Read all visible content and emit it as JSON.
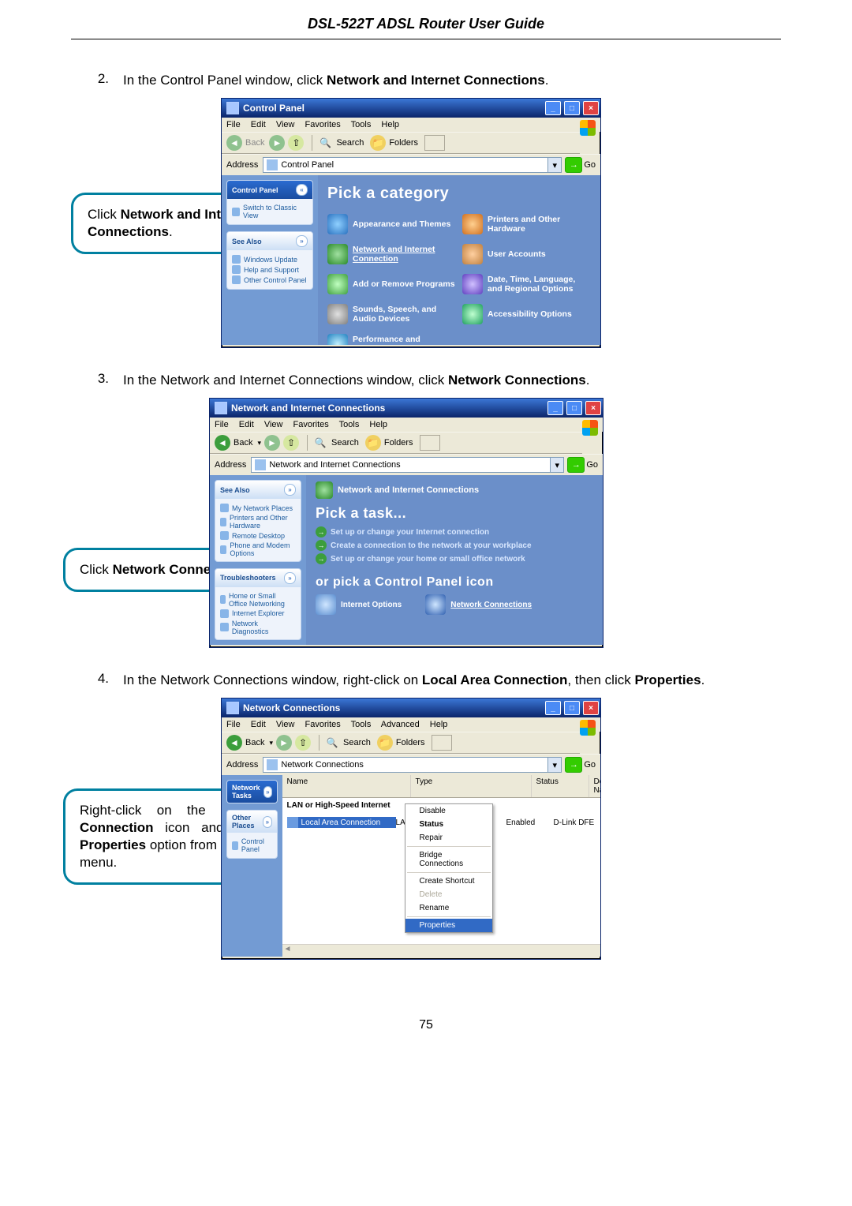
{
  "header_title": "DSL-522T ADSL Router User Guide",
  "page_number": "75",
  "steps": {
    "s2_num": "2.",
    "s2_text_prefix": "In the Control Panel window, click ",
    "s2_text_bold": "Network and Internet Connections",
    "s2_text_suffix": ".",
    "s3_num": "3.",
    "s3_text_prefix": "In the Network and Internet Connections window, click ",
    "s3_text_bold": "Network Connections",
    "s3_text_suffix": ".",
    "s4_num": "4.",
    "s4_text_prefix": "In the Network Connections window, right-click on ",
    "s4_text_bold1": "Local Area Connection",
    "s4_text_mid": ", then click ",
    "s4_text_bold2": "Properties",
    "s4_text_suffix": "."
  },
  "callouts": {
    "c1_pre": "Click ",
    "c1_b1": "Network and Internet Connections",
    "c1_post": ".",
    "c2_pre": "Click ",
    "c2_b1": "Network Connections",
    "c2_post": ".",
    "c3_line1_pre": "Right-click on the ",
    "c3_line1_b1": "Local Area Connection",
    "c3_line1_mid": " icon and select the ",
    "c3_line1_b2": "Properties",
    "c3_line1_post": " option from the pull-down menu."
  },
  "menus": [
    "File",
    "Edit",
    "View",
    "Favorites",
    "Tools",
    "Help"
  ],
  "menus2": [
    "File",
    "Edit",
    "View",
    "Favorites",
    "Tools",
    "Advanced",
    "Help"
  ],
  "toolbar": {
    "back": "Back",
    "search": "Search",
    "folders": "Folders"
  },
  "addressLabel": "Address",
  "go": "Go",
  "win1": {
    "title": "Control Panel",
    "addr": "Control Panel",
    "side_h1": "Control Panel",
    "side_link1": "Switch to Classic View",
    "side_h2": "See Also",
    "side_l2a": "Windows Update",
    "side_l2b": "Help and Support",
    "side_l2c": "Other Control Panel",
    "heading": "Pick a category",
    "cats": {
      "c0": "Appearance and Themes",
      "c1": "Printers and Other Hardware",
      "c2": "Network and Internet Connection",
      "c3": "User Accounts",
      "c4": "Add or Remove Programs",
      "c5": "Date, Time, Language, and Regional Options",
      "c6": "Sounds, Speech, and Audio Devices",
      "c7": "Accessibility Options",
      "c8": "Performance and Maintenance"
    }
  },
  "win2": {
    "title": "Network and Internet Connections",
    "addr": "Network and Internet Connections",
    "side_h1": "See Also",
    "side_l1a": "My Network Places",
    "side_l1b": "Printers and Other Hardware",
    "side_l1c": "Remote Desktop",
    "side_l1d": "Phone and Modem Options",
    "side_h2": "Troubleshooters",
    "side_l2a": "Home or Small Office Networking",
    "side_l2b": "Internet Explorer",
    "side_l2c": "Network Diagnostics",
    "crumb": "Network and Internet Connections",
    "heading1": "Pick a task...",
    "t1": "Set up or change your Internet connection",
    "t2": "Create a connection to the network at your workplace",
    "t3": "Set up or change your home or small office network",
    "heading2": "or pick a Control Panel icon",
    "i1": "Internet Options",
    "i2": "Network Connections"
  },
  "win3": {
    "title": "Network Connections",
    "addr": "Network Connections",
    "side_h1": "Network Tasks",
    "side_h2": "Other Places",
    "side_l2a": "Control Panel",
    "cols": {
      "name": "Name",
      "type": "Type",
      "status": "Status",
      "device": "Device Na"
    },
    "group": "LAN or High-Speed Internet",
    "conn_name": "Local Area Connection",
    "conn_type": "LAN or High-Speed Inter...",
    "conn_status": "Enabled",
    "conn_device": "D-Link DFE",
    "ctx": {
      "disable": "Disable",
      "status": "Status",
      "repair": "Repair",
      "bridge": "Bridge Connections",
      "shortcut": "Create Shortcut",
      "delete": "Delete",
      "rename": "Rename",
      "props": "Properties"
    }
  }
}
